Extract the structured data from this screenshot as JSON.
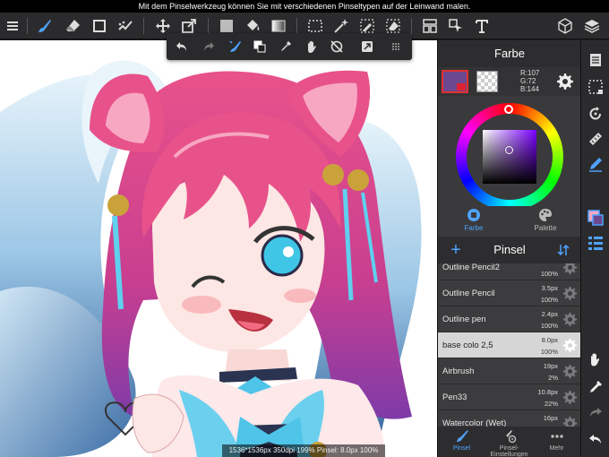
{
  "hint_text": "Mit dem Pinselwerkzeug können Sie mit verschiedenen Pinseltypen auf der Leinwand malen.",
  "status_text": "1536*1536px 350dpi 199% Pinsel: 8.0px 100%",
  "colors": {
    "primary": "#6b4890",
    "accent": "#4fa3ff",
    "selected_row": "#d6d6d6"
  },
  "color_panel": {
    "title": "Farbe",
    "rgb": {
      "r": "R:107",
      "g": "G:72",
      "b": "B:144"
    },
    "tabs": [
      {
        "label": "Farbe",
        "icon": "color-wheel-icon"
      },
      {
        "label": "Palette",
        "icon": "palette-icon"
      }
    ]
  },
  "brush_panel": {
    "title": "Pinsel",
    "brushes": [
      {
        "name": "Outline Pencil2",
        "size": "",
        "opacity": "100%"
      },
      {
        "name": "Outline Pencil",
        "size": "3.5px",
        "opacity": "100%"
      },
      {
        "name": "Outline pen",
        "size": "2.4px",
        "opacity": "100%"
      },
      {
        "name": "base colo 2,5",
        "size": "8.0px",
        "opacity": "100%"
      },
      {
        "name": "Airbrush",
        "size": "19px",
        "opacity": "2%"
      },
      {
        "name": "Pen33",
        "size": "10.8px",
        "opacity": "22%"
      },
      {
        "name": "Watercolor (Wet)",
        "size": "16px",
        "opacity": ""
      }
    ],
    "bottom_tabs": [
      {
        "label": "Pinsel",
        "icon": "brush-icon"
      },
      {
        "label": "Pinsel-Einstellungen",
        "icon": "brush-settings-icon"
      },
      {
        "label": "Mehr",
        "icon": "more-icon"
      }
    ]
  }
}
